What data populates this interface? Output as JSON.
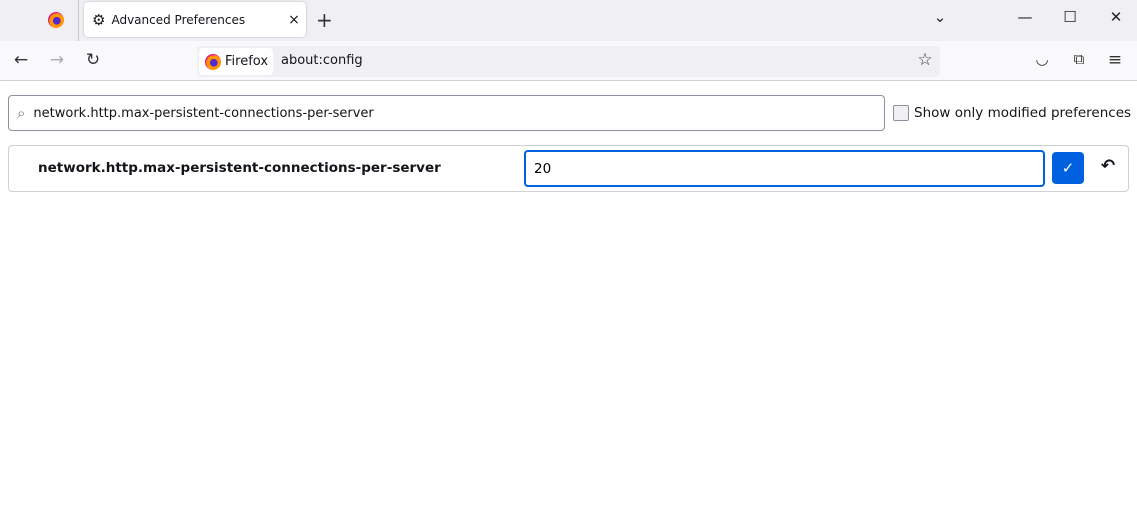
{
  "tab": {
    "title": "Advanced Preferences",
    "close": "×",
    "new": "+"
  },
  "window": {
    "list": "⌄",
    "minimize": "—",
    "maximize": "☐",
    "close": "✕"
  },
  "nav": {
    "back": "←",
    "forward": "→",
    "reload": "↻",
    "identity": "Firefox",
    "url": "about:config",
    "bookmark": "☆",
    "pocket": "◡",
    "extensions": "⧉",
    "menu": "≡"
  },
  "search": {
    "value": "network.http.max-persistent-connections-per-server",
    "icon": "⌕"
  },
  "filter": {
    "label": "Show only modified preferences",
    "checked": false
  },
  "pref": {
    "name": "network.http.max-persistent-connections-per-server",
    "value": "20",
    "save": "✓",
    "revert": "↶"
  },
  "colors": {
    "accent": "#0061e0"
  }
}
